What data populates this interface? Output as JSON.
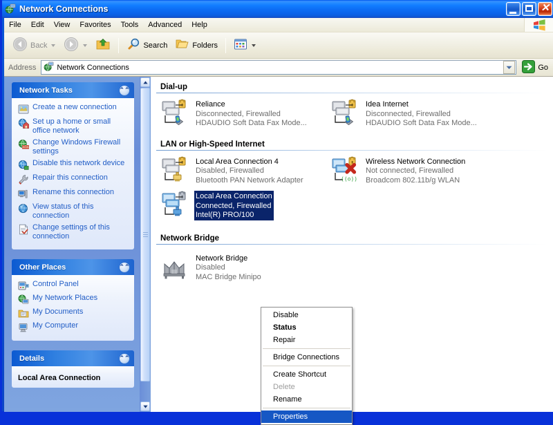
{
  "window": {
    "title": "Network Connections",
    "icon": "network-connections-icon",
    "buttons": {
      "minimize": "minimize",
      "maximize": "maximize",
      "close": "close"
    }
  },
  "menubar": {
    "items": [
      {
        "label": "File"
      },
      {
        "label": "Edit"
      },
      {
        "label": "View"
      },
      {
        "label": "Favorites"
      },
      {
        "label": "Tools"
      },
      {
        "label": "Advanced"
      },
      {
        "label": "Help"
      }
    ],
    "brand_icon": "windows-flag-icon"
  },
  "toolbar": {
    "back_label": "Back",
    "back_icon": "back-arrow-icon",
    "forward_icon": "forward-arrow-icon",
    "up_icon": "up-folder-icon",
    "search_label": "Search",
    "search_icon": "search-icon",
    "folders_label": "Folders",
    "folders_icon": "folders-icon",
    "views_icon": "views-icon"
  },
  "address": {
    "label": "Address",
    "value": "Network Connections",
    "icon": "network-connections-icon",
    "dropdown_icon": "chevron-down-icon",
    "go_label": "Go",
    "go_icon": "go-arrow-icon"
  },
  "sidebar": {
    "panels": [
      {
        "title": "Network Tasks",
        "collapse_icon": "chevron-up-icon",
        "items": [
          {
            "label": "Create a new connection",
            "icon": "new-connection-icon"
          },
          {
            "label": "Set up a home or small office network",
            "icon": "home-network-icon"
          },
          {
            "label": "Change Windows Firewall settings",
            "icon": "firewall-icon"
          },
          {
            "label": "Disable this network device",
            "icon": "disable-device-icon"
          },
          {
            "label": "Repair this connection",
            "icon": "repair-icon"
          },
          {
            "label": "Rename this connection",
            "icon": "rename-icon"
          },
          {
            "label": "View status of this connection",
            "icon": "view-status-icon"
          },
          {
            "label": "Change settings of this connection",
            "icon": "settings-icon"
          }
        ]
      },
      {
        "title": "Other Places",
        "collapse_icon": "chevron-up-icon",
        "items": [
          {
            "label": "Control Panel",
            "icon": "control-panel-icon"
          },
          {
            "label": "My Network Places",
            "icon": "my-network-places-icon"
          },
          {
            "label": "My Documents",
            "icon": "my-documents-icon"
          },
          {
            "label": "My Computer",
            "icon": "my-computer-icon"
          }
        ]
      },
      {
        "title": "Details",
        "collapse_icon": "chevron-up-icon",
        "detail_name": "Local Area Connection"
      }
    ]
  },
  "content": {
    "sections": [
      {
        "heading": "Dial-up",
        "connections": [
          {
            "name": "Reliance",
            "status": "Disconnected, Firewalled",
            "device": "HDAUDIO Soft Data Fax Mode...",
            "icon": "dialup-connection-icon",
            "selected": false
          },
          {
            "name": "Idea Internet",
            "status": "Disconnected, Firewalled",
            "device": "HDAUDIO Soft Data Fax Mode...",
            "icon": "dialup-connection-icon",
            "selected": false
          }
        ]
      },
      {
        "heading": "LAN or High-Speed Internet",
        "connections": [
          {
            "name": "Local Area Connection 4",
            "status": "Disabled, Firewalled",
            "device": "Bluetooth PAN Network Adapter",
            "icon": "lan-disabled-icon",
            "selected": false
          },
          {
            "name": "Wireless Network Connection",
            "status": "Not connected, Firewalled",
            "device": "Broadcom 802.11b/g WLAN",
            "icon": "wireless-disconnected-icon",
            "selected": false
          },
          {
            "name": "Local Area Connection",
            "status": "Connected, Firewalled",
            "device": "Intel(R) PRO/100",
            "icon": "lan-connected-icon",
            "selected": true
          }
        ]
      },
      {
        "heading": "Network Bridge",
        "connections": [
          {
            "name": "Network Bridge",
            "status": "Disabled",
            "device": "MAC Bridge Minipo",
            "icon": "network-bridge-icon",
            "selected": false
          }
        ]
      }
    ]
  },
  "context_menu": {
    "items": [
      {
        "label": "Disable",
        "style": "normal",
        "separator_after": false
      },
      {
        "label": "Status",
        "style": "bold",
        "separator_after": false
      },
      {
        "label": "Repair",
        "style": "normal",
        "separator_after": true
      },
      {
        "label": "Bridge Connections",
        "style": "normal",
        "separator_after": true
      },
      {
        "label": "Create Shortcut",
        "style": "normal",
        "separator_after": false
      },
      {
        "label": "Delete",
        "style": "disabled",
        "separator_after": false
      },
      {
        "label": "Rename",
        "style": "normal",
        "separator_after": true
      },
      {
        "label": "Properties",
        "style": "selected",
        "separator_after": false
      }
    ]
  },
  "colors": {
    "titlebar_blue": "#0a56d6",
    "sidebar_blue": "#6e92d9",
    "selection_navy": "#0a246a",
    "menu_highlight": "#1657c4",
    "link_blue": "#215dc6"
  }
}
